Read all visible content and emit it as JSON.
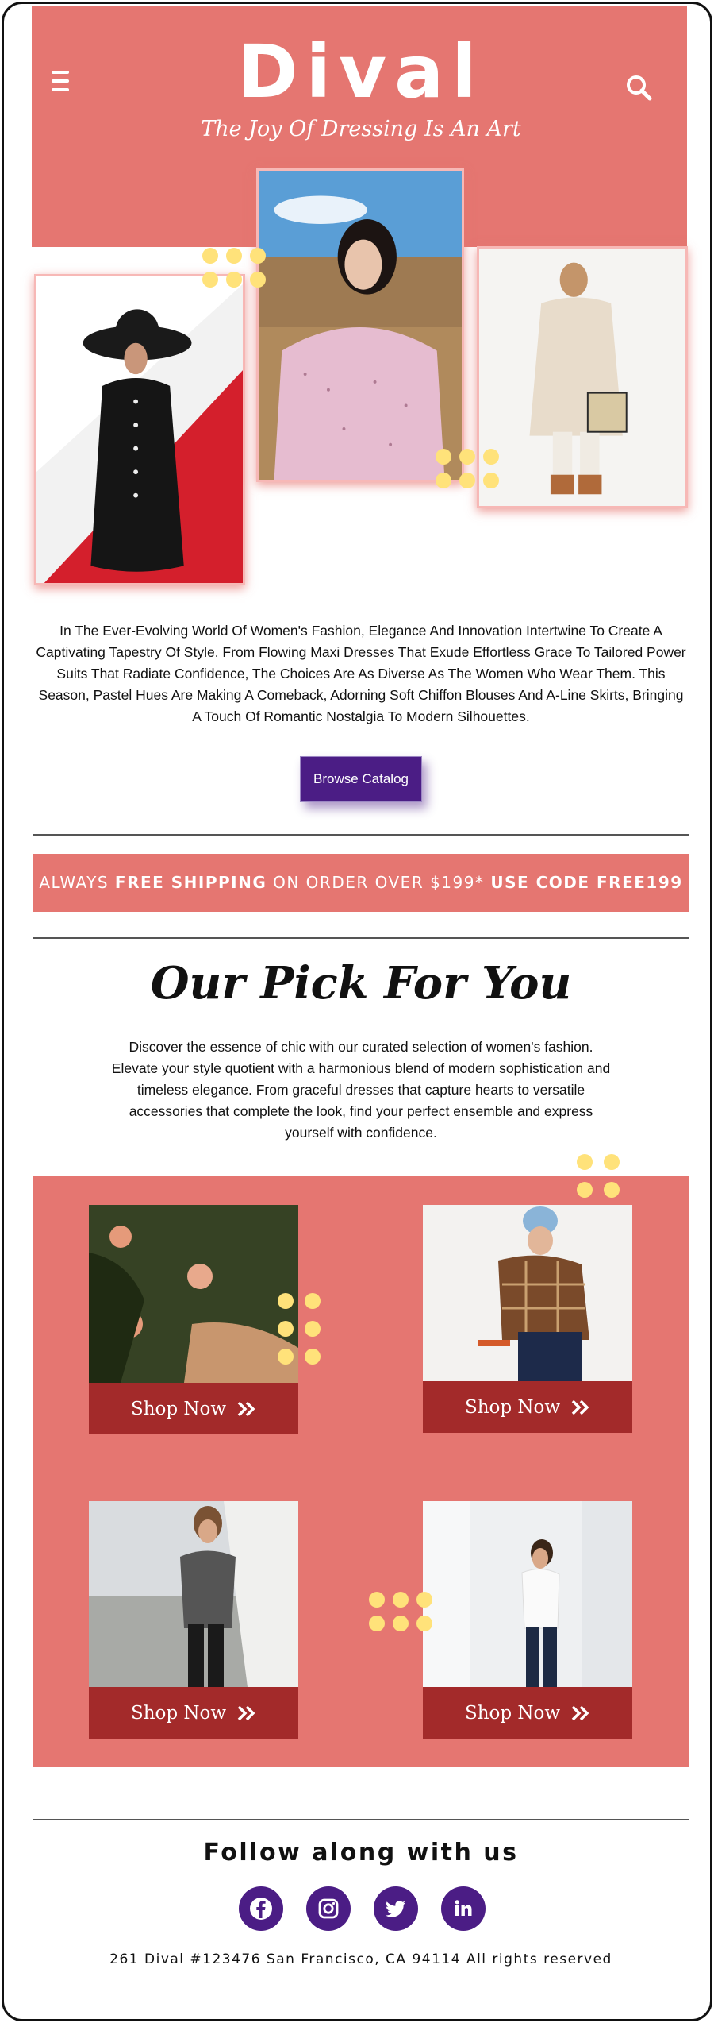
{
  "header": {
    "brand": "Dival",
    "tagline": "The Joy Of Dressing Is An Art",
    "menu_icon": "hamburger-menu-icon",
    "search_icon": "search-icon"
  },
  "hero": {
    "description": "In The Ever-Evolving World Of Women's Fashion, Elegance And Innovation Intertwine To Create A Captivating Tapestry Of Style. From Flowing Maxi Dresses That Exude Effortless Grace To Tailored Power Suits That Radiate Confidence, The Choices Are As Diverse As The Women Who Wear Them. This Season, Pastel Hues Are Making A Comeback, Adorning Soft Chiffon Blouses And A-Line Skirts, Bringing A Touch Of Romantic Nostalgia To Modern Silhouettes.",
    "cta_label": "Browse Catalog"
  },
  "shipping": {
    "prefix": "ALWAYS ",
    "highlight": "FREE SHIPPING",
    "middle": " ON ORDER OVER $199* ",
    "code": "USE CODE FREE199"
  },
  "picks": {
    "title": "Our Pick For You",
    "description": "Discover the essence of chic with our curated selection of women's fashion. Elevate your style quotient with a harmonious blend of modern sophistication and timeless elegance. From graceful dresses that capture hearts to versatile accessories that complete the look, find your perfect ensemble and express yourself with confidence.",
    "products": [
      {
        "button_label": "Shop Now"
      },
      {
        "button_label": "Shop Now"
      },
      {
        "button_label": "Shop Now"
      },
      {
        "button_label": "Shop Now"
      }
    ]
  },
  "footer": {
    "follow_title": "Follow along with us",
    "social": [
      {
        "icon": "facebook-icon"
      },
      {
        "icon": "instagram-icon"
      },
      {
        "icon": "twitter-icon"
      },
      {
        "icon": "linkedin-icon"
      }
    ],
    "address": "261 Dival #123476 San Francisco, CA 94114 All rights reserved"
  },
  "colors": {
    "brand_coral": "#e57671",
    "button_purple": "#4b1d85",
    "shop_button_red": "#a32a2a",
    "dot_yellow": "#ffe27a"
  }
}
